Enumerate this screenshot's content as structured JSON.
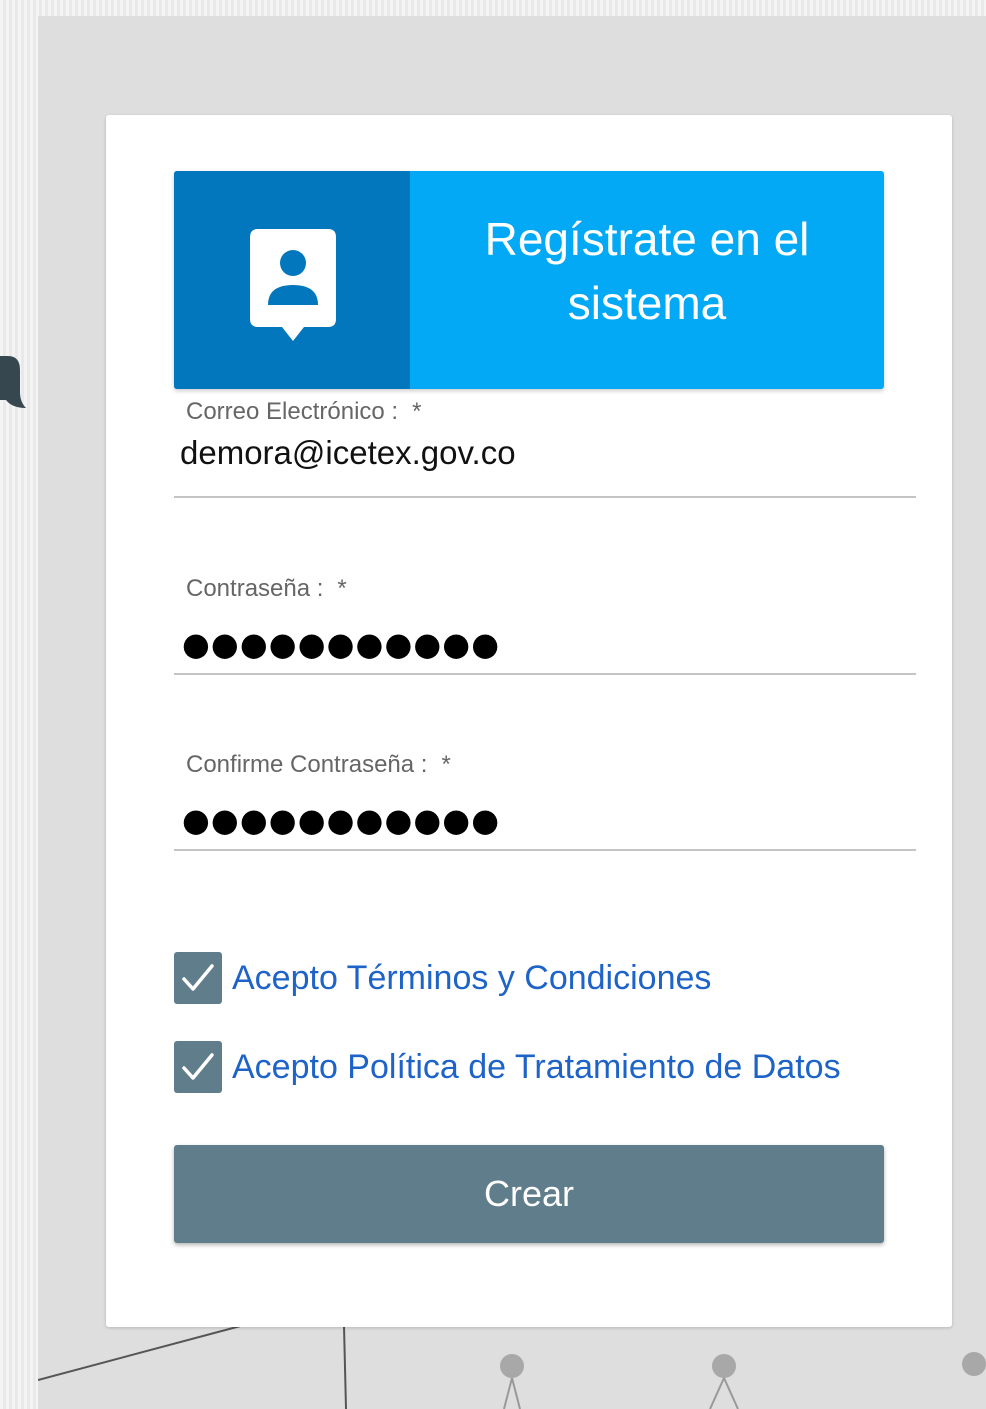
{
  "header": {
    "title_line1": "Regístrate en el",
    "title_line2": "sistema",
    "icon": "contact-user-icon"
  },
  "form": {
    "email": {
      "label": "Correo Electrónico :",
      "required_mark": "*",
      "value": "demora@icetex.gov.co"
    },
    "password": {
      "label": "Contraseña :",
      "required_mark": "*",
      "value": "●●●●●●●●●●●"
    },
    "confirm_password": {
      "label": "Confirme Contraseña :",
      "required_mark": "*",
      "value": "●●●●●●●●●●●"
    },
    "terms": {
      "label": "Acepto Términos y Condiciones",
      "checked": true
    },
    "data_policy": {
      "label": "Acepto Política de Tratamiento de Datos",
      "checked": true
    },
    "submit_label": "Crear"
  },
  "colors": {
    "header_light": "#03a9f4",
    "header_dark": "#0277bd",
    "button": "#607d8b",
    "link": "#1e63c8"
  }
}
